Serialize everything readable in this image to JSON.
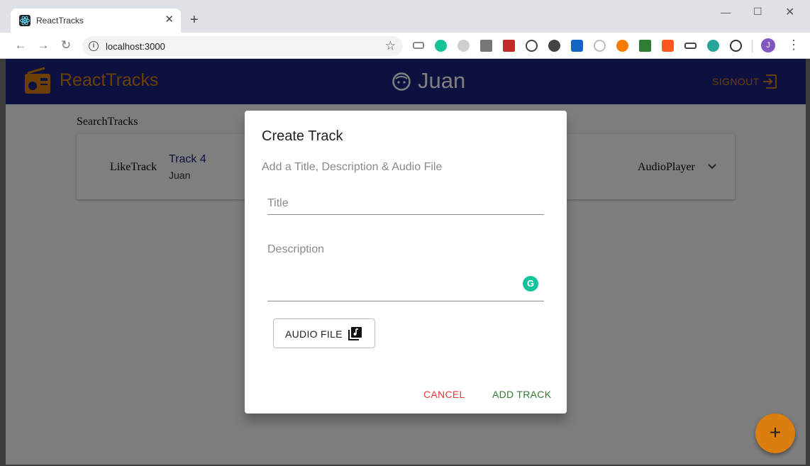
{
  "browser": {
    "tab_title": "ReactTracks",
    "url": "localhost:3000",
    "profile_initial": "J"
  },
  "app": {
    "brand": "ReactTracks",
    "username": "Juan",
    "signout": "SIGNOUT",
    "search_label": "SearchTracks",
    "track": {
      "like": "LikeTrack",
      "title": "Track 4",
      "owner": "Juan",
      "player": "AudioPlayer"
    },
    "fab_label": "+"
  },
  "dialog": {
    "title": "Create Track",
    "subtitle": "Add a Title, Description & Audio File",
    "title_placeholder": "Title",
    "description_placeholder": "Description",
    "audio_button": "AUDIO FILE",
    "cancel": "CANCEL",
    "add": "ADD TRACK"
  },
  "colors": {
    "appbar": "#1a237e",
    "accent": "#d97e0f",
    "cancel": "#e53935",
    "add": "#2e7d32"
  }
}
